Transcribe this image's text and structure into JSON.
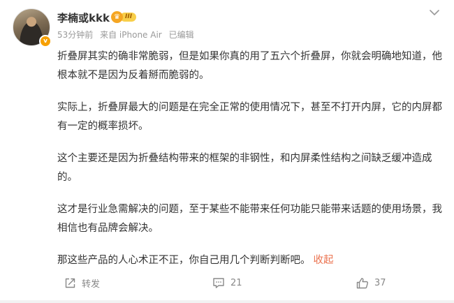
{
  "post": {
    "author": {
      "name": "李楠或kkk",
      "vip_level": "III",
      "avatar_badge": "v"
    },
    "meta": {
      "time": "53分钟前",
      "source": "来自 iPhone Air",
      "edited": "已编辑"
    },
    "body": [
      "折叠屏其实的确非常脆弱，但是如果你真的用了五六个折叠屏，你就会明确地知道，他根本就不是因为反着掰而脆弱的。",
      "实际上，折叠屏最大的问题是在完全正常的使用情况下，甚至不打开内屏，它的内屏都有一定的概率损坏。",
      "这个主要还是因为折叠结构带来的框架的非钢性，和内屏柔性结构之间缺乏缓冲造成的。",
      "这才是行业急需解决的问题，至于某些不能带来任何功能只能带来话题的使用场景，我相信也有品牌会解决。",
      "那这些产品的人心术正不正，你自己用几个判断判断吧。"
    ],
    "collapse_label": "收起",
    "actions": {
      "repost_label": "转发",
      "comment_count": "21",
      "like_count": "37"
    },
    "icons": {
      "menu": "chevron-down-icon",
      "repost": "share-icon",
      "comment": "comment-icon",
      "like": "thumbs-up-icon",
      "vip": "crown-icon"
    },
    "colors": {
      "link": "#eb7350",
      "meta_text": "#999999",
      "body_text": "#333333",
      "vip_gold": "#f5a623",
      "badge_orange": "#f7a000"
    }
  }
}
